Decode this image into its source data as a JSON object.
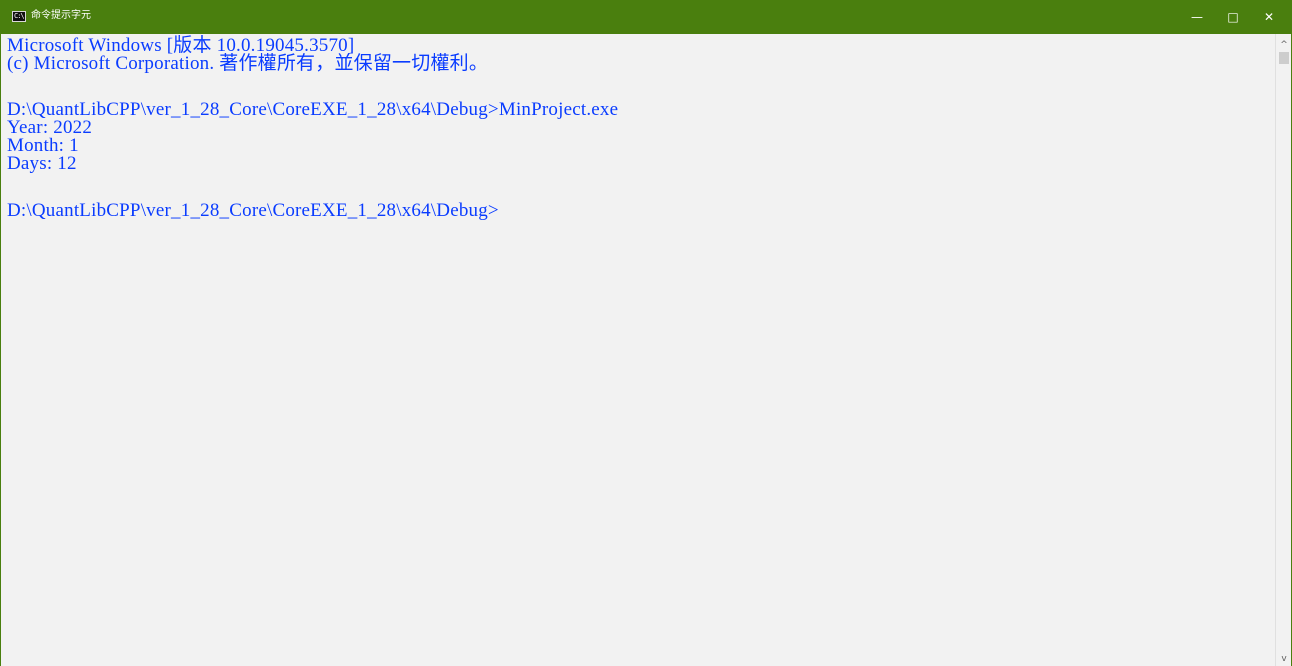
{
  "window": {
    "title": "命令提示字元",
    "icon": "cmd-icon",
    "icon_text": "C:\\",
    "accent_color": "#4a7f0e",
    "controls": {
      "minimize": "—",
      "maximize": "□",
      "close": "✕"
    }
  },
  "console": {
    "text_color": "#0a3cff",
    "background": "#f2f2f2",
    "lines": [
      "Microsoft Windows [版本 10.0.19045.3570]",
      "(c) Microsoft Corporation. 著作權所有，並保留一切權利。",
      "",
      "D:\\QuantLibCPP\\ver_1_28_Core\\CoreEXE_1_28\\x64\\Debug>MinProject.exe",
      "Year: 2022",
      "Month: 1",
      "Days: 12",
      "",
      "D:\\QuantLibCPP\\ver_1_28_Core\\CoreEXE_1_28\\x64\\Debug>"
    ]
  },
  "scrollbar": {
    "up_arrow": "^",
    "down_arrow": "v"
  }
}
